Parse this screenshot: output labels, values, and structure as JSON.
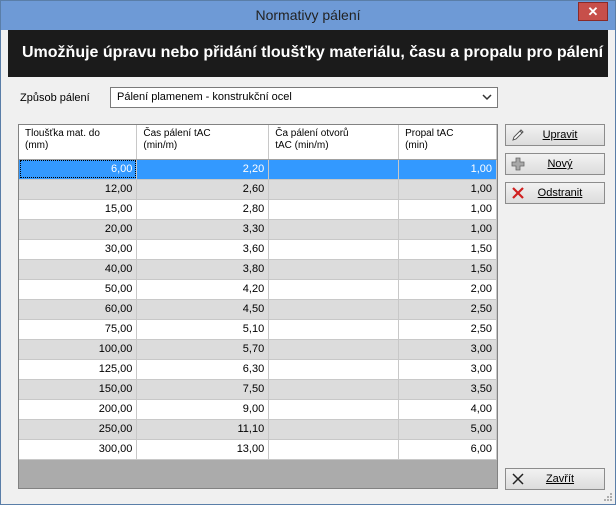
{
  "window": {
    "title": "Normativy pálení"
  },
  "banner": {
    "text": "Umožňuje úpravu nebo přidání tloušťky materiálu, času a propalu pro pálení"
  },
  "method": {
    "label": "Způsob pálení",
    "selected": "Pálení plamenem - konstrukční ocel"
  },
  "grid": {
    "columns": [
      {
        "line1": "Tloušťka mat. do",
        "line2": "(mm)"
      },
      {
        "line1": "Čas pálení tAC",
        "line2": "(min/m)"
      },
      {
        "line1": "Ča pálení otvorů",
        "line2": "tAC (min/m)"
      },
      {
        "line1": "Propal tAC",
        "line2": "(min)"
      }
    ],
    "rows": [
      [
        "6,00",
        "2,20",
        "",
        "1,00"
      ],
      [
        "12,00",
        "2,60",
        "",
        "1,00"
      ],
      [
        "15,00",
        "2,80",
        "",
        "1,00"
      ],
      [
        "20,00",
        "3,30",
        "",
        "1,00"
      ],
      [
        "30,00",
        "3,60",
        "",
        "1,50"
      ],
      [
        "40,00",
        "3,80",
        "",
        "1,50"
      ],
      [
        "50,00",
        "4,20",
        "",
        "2,00"
      ],
      [
        "60,00",
        "4,50",
        "",
        "2,50"
      ],
      [
        "75,00",
        "5,10",
        "",
        "2,50"
      ],
      [
        "100,00",
        "5,70",
        "",
        "3,00"
      ],
      [
        "125,00",
        "6,30",
        "",
        "3,00"
      ],
      [
        "150,00",
        "7,50",
        "",
        "3,50"
      ],
      [
        "200,00",
        "9,00",
        "",
        "4,00"
      ],
      [
        "250,00",
        "11,10",
        "",
        "5,00"
      ],
      [
        "300,00",
        "13,00",
        "",
        "6,00"
      ]
    ]
  },
  "buttons": {
    "edit": "Upravit",
    "new": "Nový",
    "delete": "Odstranit",
    "close": "Zavřít"
  },
  "icons": {
    "edit": "pencil-icon",
    "new": "plus-icon",
    "delete": "red-x-icon",
    "close": "x-icon"
  },
  "colors": {
    "selected_row": "#3399ff",
    "banner": "#1b1b1b",
    "titlebar": "#6e9ad6"
  }
}
